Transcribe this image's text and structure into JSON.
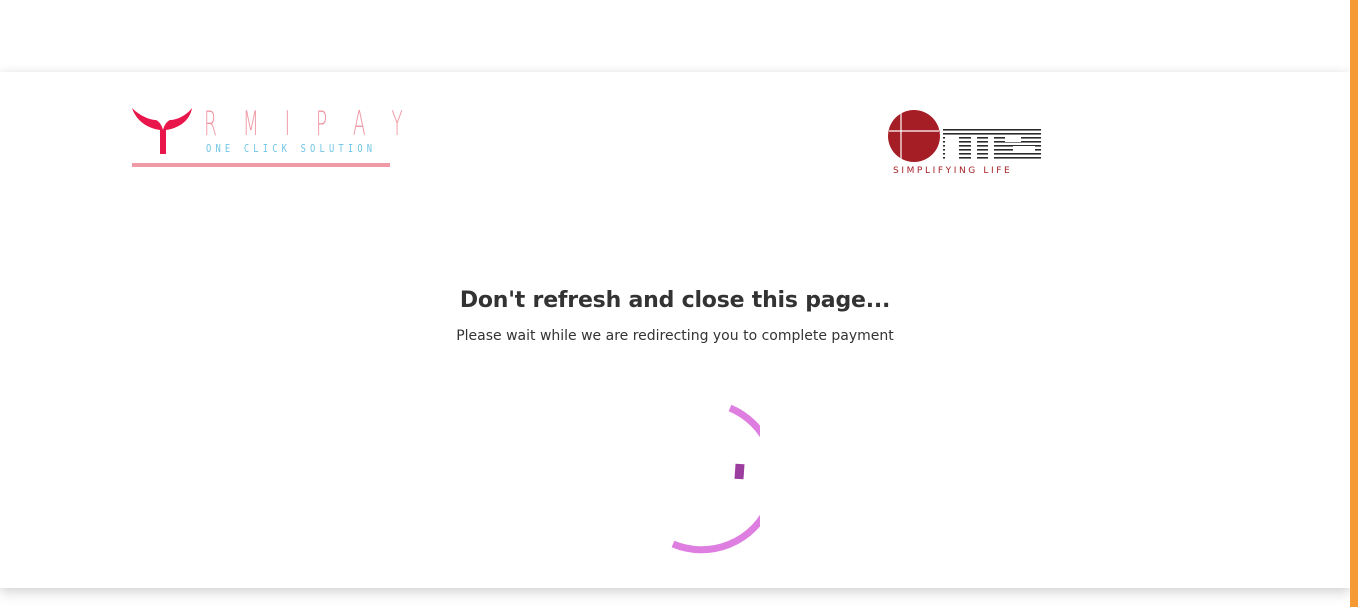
{
  "brand": {
    "name": "RMIPAY",
    "wordmark": "RMIPAY",
    "letters": "R M I P A Y",
    "tagline": "ONE CLICK SOLUTION",
    "colors": {
      "pink": "#ef9aa6",
      "red": "#e8164b",
      "blue": "#6fc5e4"
    }
  },
  "partner": {
    "name": "CMS",
    "wordmark": "cms",
    "tagline": "SIMPLIFYING   LIFE",
    "colors": {
      "red": "#a61e25",
      "dark": "#333333"
    }
  },
  "message": {
    "heading": "Don't refresh and close this page...",
    "subtext": "Please wait while we are redirecting you to complete payment"
  },
  "spinner": {
    "icon": "loading-spinner-icon",
    "outer_color": "#dd7ee0",
    "inner_color": "#9b3ea0"
  },
  "scrollbar": {
    "color": "#f59a35"
  }
}
